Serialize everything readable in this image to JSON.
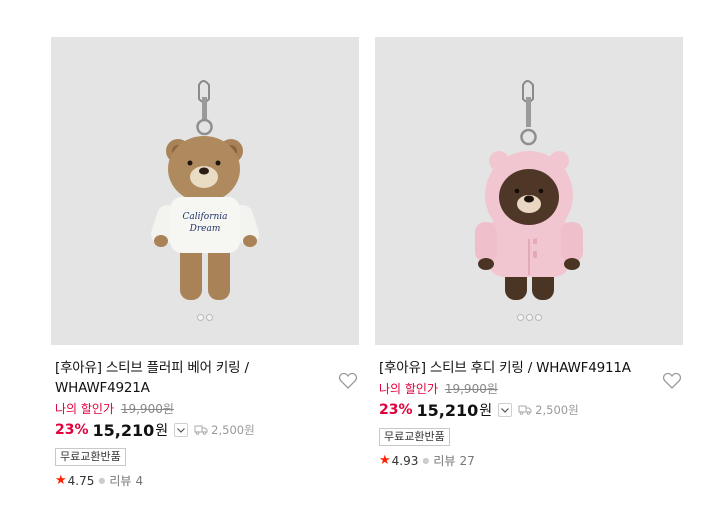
{
  "products": [
    {
      "title_line1": "[후아유] 스티브 플러피 베어 키링 /",
      "title_line2": "WHAWF4921A",
      "discount_label": "나의 할인가",
      "original_price": "19,900원",
      "discount_rate": "23%",
      "price": "15,210",
      "currency": "원",
      "shipping": "2,500원",
      "badge": "무료교환반품",
      "star": "★",
      "rating": "4.75",
      "review_label": "리뷰",
      "review_count": "4",
      "image_dots": 2,
      "image": "bear keyring with white knit sweater",
      "sweater_text": "California Dream"
    },
    {
      "title_line1": "[후아유] 스티브 후디 키링 / WHAWF4911A",
      "title_line2": "",
      "discount_label": "나의 할인가",
      "original_price": "19,900원",
      "discount_rate": "23%",
      "price": "15,210",
      "currency": "원",
      "shipping": "2,500원",
      "badge": "무료교환반품",
      "star": "★",
      "rating": "4.93",
      "review_label": "리뷰",
      "review_count": "27",
      "image_dots": 3,
      "image": "bear keyring with pink hoodie"
    }
  ],
  "colors": {
    "discount": "#e0003c",
    "star": "#ff2200",
    "image_bg": "#e4e4e4"
  },
  "icons": [
    "heart-icon",
    "chevron-down-icon",
    "truck-icon",
    "star-icon"
  ]
}
